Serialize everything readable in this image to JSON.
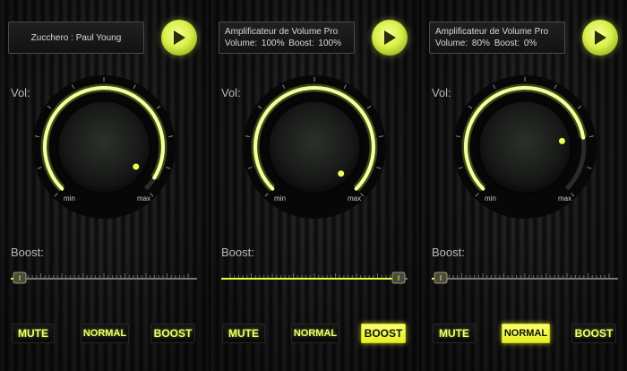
{
  "panels": [
    {
      "info_line1": "Zucchero : Paul Young",
      "info_line2": "",
      "vol_label": "Vol:",
      "min_label": "min",
      "max_label": "max",
      "volume_level": 0.95,
      "boost_label": "Boost:",
      "boost_level": 0.0,
      "buttons": {
        "mute": "MUTE",
        "normal": "NORMAL",
        "boost": "BOOST"
      },
      "active_mode": "none"
    },
    {
      "info_line1": "Amplificateur de Volume Pro",
      "info_line2": "Volume: 100%   Boost: 100%",
      "vol_label": "Vol:",
      "min_label": "min",
      "max_label": "max",
      "volume_level": 1.0,
      "boost_label": "Boost:",
      "boost_level": 1.0,
      "buttons": {
        "mute": "MUTE",
        "normal": "NORMAL",
        "boost": "BOOST"
      },
      "active_mode": "boost"
    },
    {
      "info_line1": "Amplificateur de Volume Pro",
      "info_line2": "Volume: 80%   Boost: 0%",
      "vol_label": "Vol:",
      "min_label": "min",
      "max_label": "max",
      "volume_level": 0.8,
      "boost_label": "Boost:",
      "boost_level": 0.0,
      "buttons": {
        "mute": "MUTE",
        "normal": "NORMAL",
        "boost": "BOOST"
      },
      "active_mode": "normal"
    }
  ],
  "colors": {
    "accent": "#e8ff3a",
    "accent_glow": "#f4ffa0",
    "background": "#1a1a1a"
  },
  "icons": {
    "play": "play-icon"
  }
}
